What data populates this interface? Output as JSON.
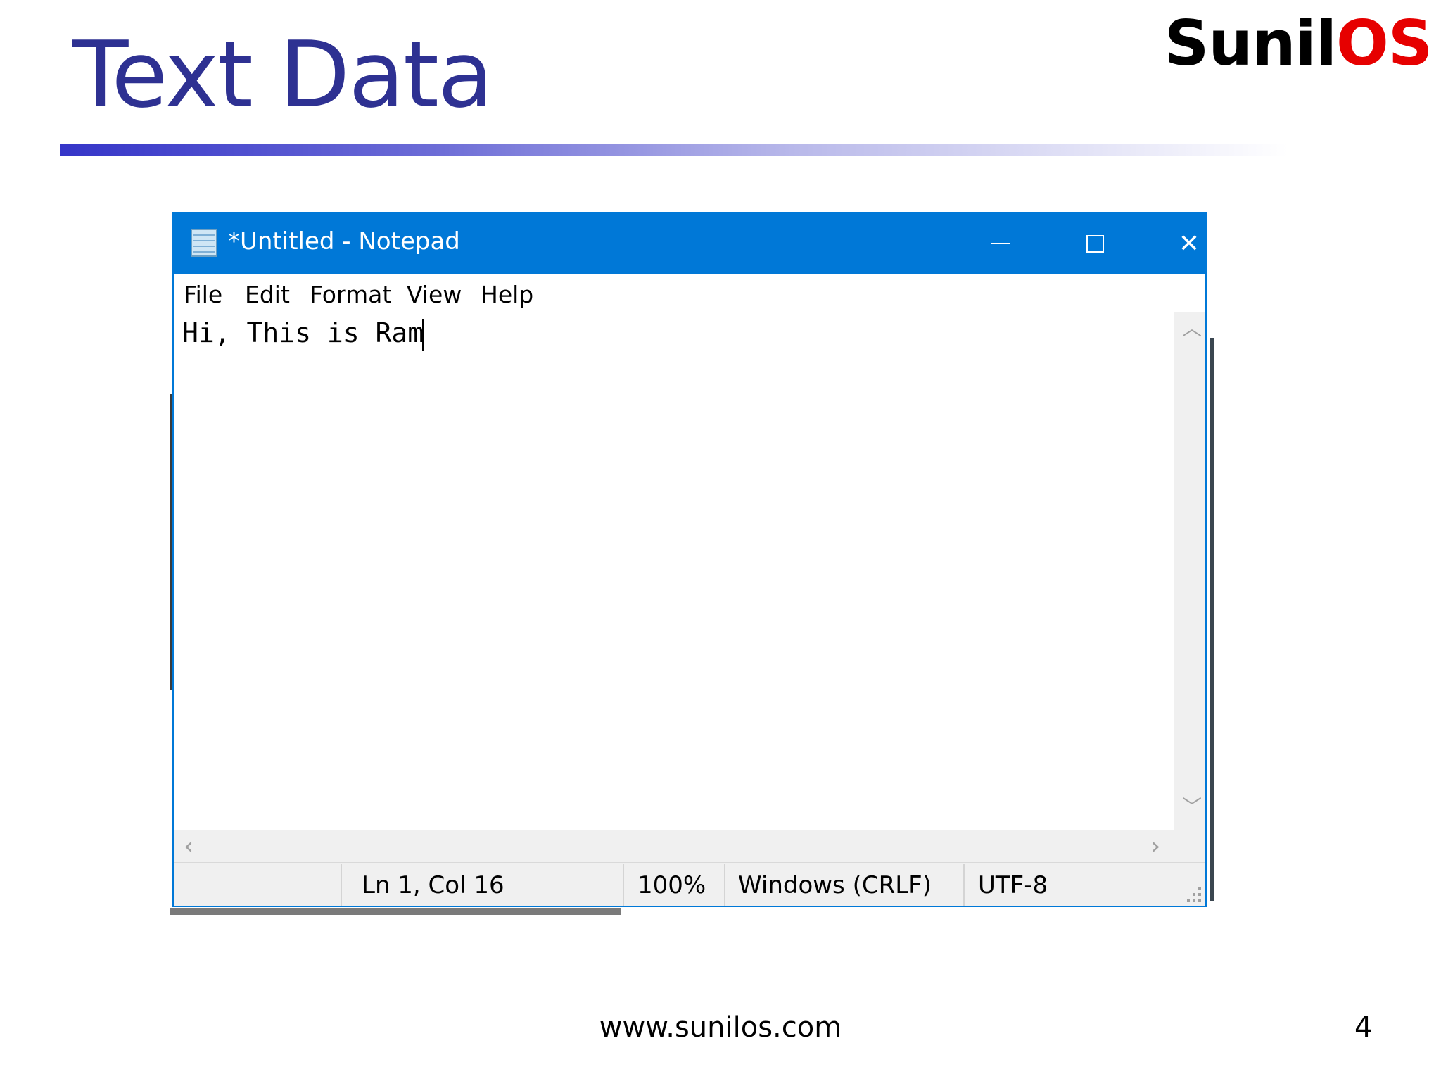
{
  "slide": {
    "title": "Text Data",
    "logo_part1": "Sunil",
    "logo_part2": "OS",
    "footer_url": "www.sunilos.com",
    "page_number": "4"
  },
  "window": {
    "title": "*Untitled - Notepad",
    "icon": "notepad-icon",
    "controls": {
      "minimize": "minimize-icon",
      "maximize": "maximize-icon",
      "close": "✕"
    }
  },
  "menu": {
    "file": "File",
    "edit": "Edit",
    "format": "Format",
    "view": "View",
    "help": "Help"
  },
  "editor": {
    "content": "Hi, This is Ram"
  },
  "scrollbars": {
    "up": "︿",
    "down": "﹀",
    "left": "‹",
    "right": "›"
  },
  "status": {
    "position": "Ln 1, Col 16",
    "zoom": "100%",
    "line_ending": "Windows (CRLF)",
    "encoding": "UTF-8"
  },
  "colors": {
    "title_text": "#2e3192",
    "titlebar": "#0078d7",
    "logo_red": "#e60000"
  }
}
